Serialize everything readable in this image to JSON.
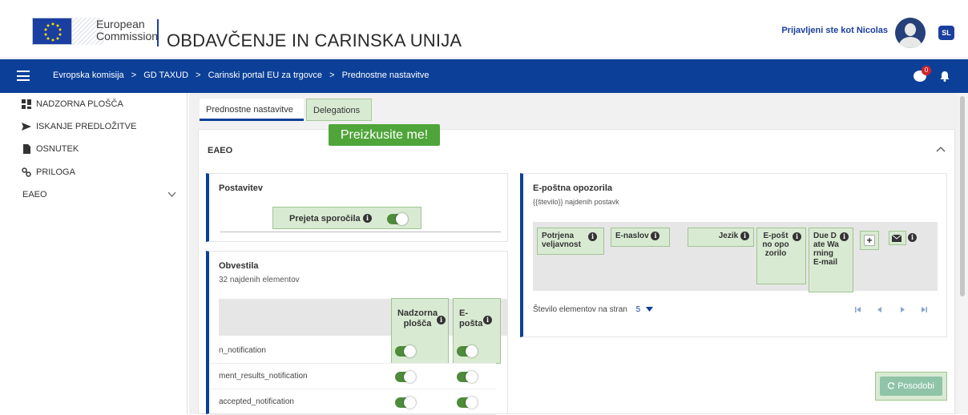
{
  "header": {
    "logo_line1": "European",
    "logo_line2": "Commission",
    "app_title": "OBDAVČENJE IN CARINSKA UNIJA",
    "user_text": "Prijavljeni ste kot Nicolas",
    "lang": "SL",
    "chat_badge": "0"
  },
  "breadcrumb": {
    "items": [
      "Evropska komisija",
      "GD TAXUD",
      "Carinski portal EU za trgovce",
      "Prednostne nastavitve"
    ],
    "separator": ">"
  },
  "sidebar": {
    "items": [
      {
        "label": "NADZORNA PLOŠČA",
        "icon": "dashboard-icon"
      },
      {
        "label": "ISKANJE PREDLOŽITVE",
        "icon": "send-icon"
      },
      {
        "label": "OSNUTEK",
        "icon": "file-icon"
      },
      {
        "label": "PRILOGA",
        "icon": "link-icon"
      },
      {
        "label": "EAEO",
        "icon": "chevron-down-icon"
      }
    ]
  },
  "tabs": {
    "preferences": "Prednostne nastavitve",
    "delegations": "Delegations"
  },
  "try_me": "Preizkusite me!",
  "section": {
    "title": "EAEO"
  },
  "settings_card": {
    "title": "Postavitev",
    "received_messages": "Prejeta sporočila"
  },
  "notifications_card": {
    "title": "Obvestila",
    "count_text": "32 najdenih elementov",
    "col_dashboard": "Nadzorna plošča",
    "col_email": "E-pošta",
    "rows": [
      {
        "name": "n_notification"
      },
      {
        "name": "ment_results_notification"
      },
      {
        "name": "accepted_notification"
      }
    ]
  },
  "email_card": {
    "title": "E-poštna opozorila",
    "count_text": "{{število}} najdenih postavk",
    "columns": [
      "Potrjena veljavnost",
      "E-naslov",
      "Jezik",
      "E-poštno opozorilo",
      "Due Date Warning E-mail"
    ],
    "add_label": "+",
    "per_page_label": "Število elementov na stran",
    "per_page_value": "5"
  },
  "refresh_button": "Posodobi"
}
